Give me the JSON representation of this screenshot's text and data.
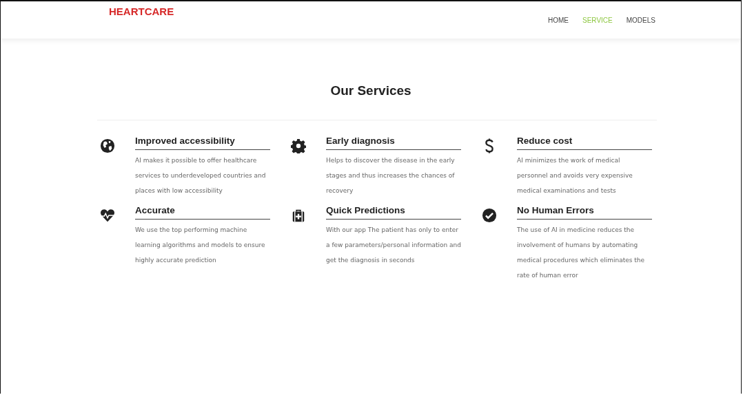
{
  "brand": "HEARTCARE",
  "nav": [
    {
      "label": "HOME",
      "selected": false
    },
    {
      "label": "SERVICE",
      "selected": true
    },
    {
      "label": "MODELS",
      "selected": false
    }
  ],
  "heading": "Our Services",
  "services": [
    {
      "title": "Improved accessibility",
      "text": "AI makes it possible to offer healthcare services to underdeveloped countries and places with low accessibility"
    },
    {
      "title": "Early diagnosis",
      "text": "Helps to discover the disease in the early stages and thus increases the chances of recovery"
    },
    {
      "title": "Reduce cost",
      "text": "AI minimizes the work of medical personnel and avoids very expensive medical examinations and tests"
    },
    {
      "title": "Accurate",
      "text": "We use the top performing machine learning algorithms and models to ensure highly accurate prediction"
    },
    {
      "title": "Quick Predictions",
      "text": "With our app The patient has only to enter a few parameters/personal information and get the diagnosis in seconds"
    },
    {
      "title": "No Human Errors",
      "text": "The use of AI in medicine reduces the involvement of humans by automating medical procedures which eliminates the rate of human error"
    }
  ]
}
